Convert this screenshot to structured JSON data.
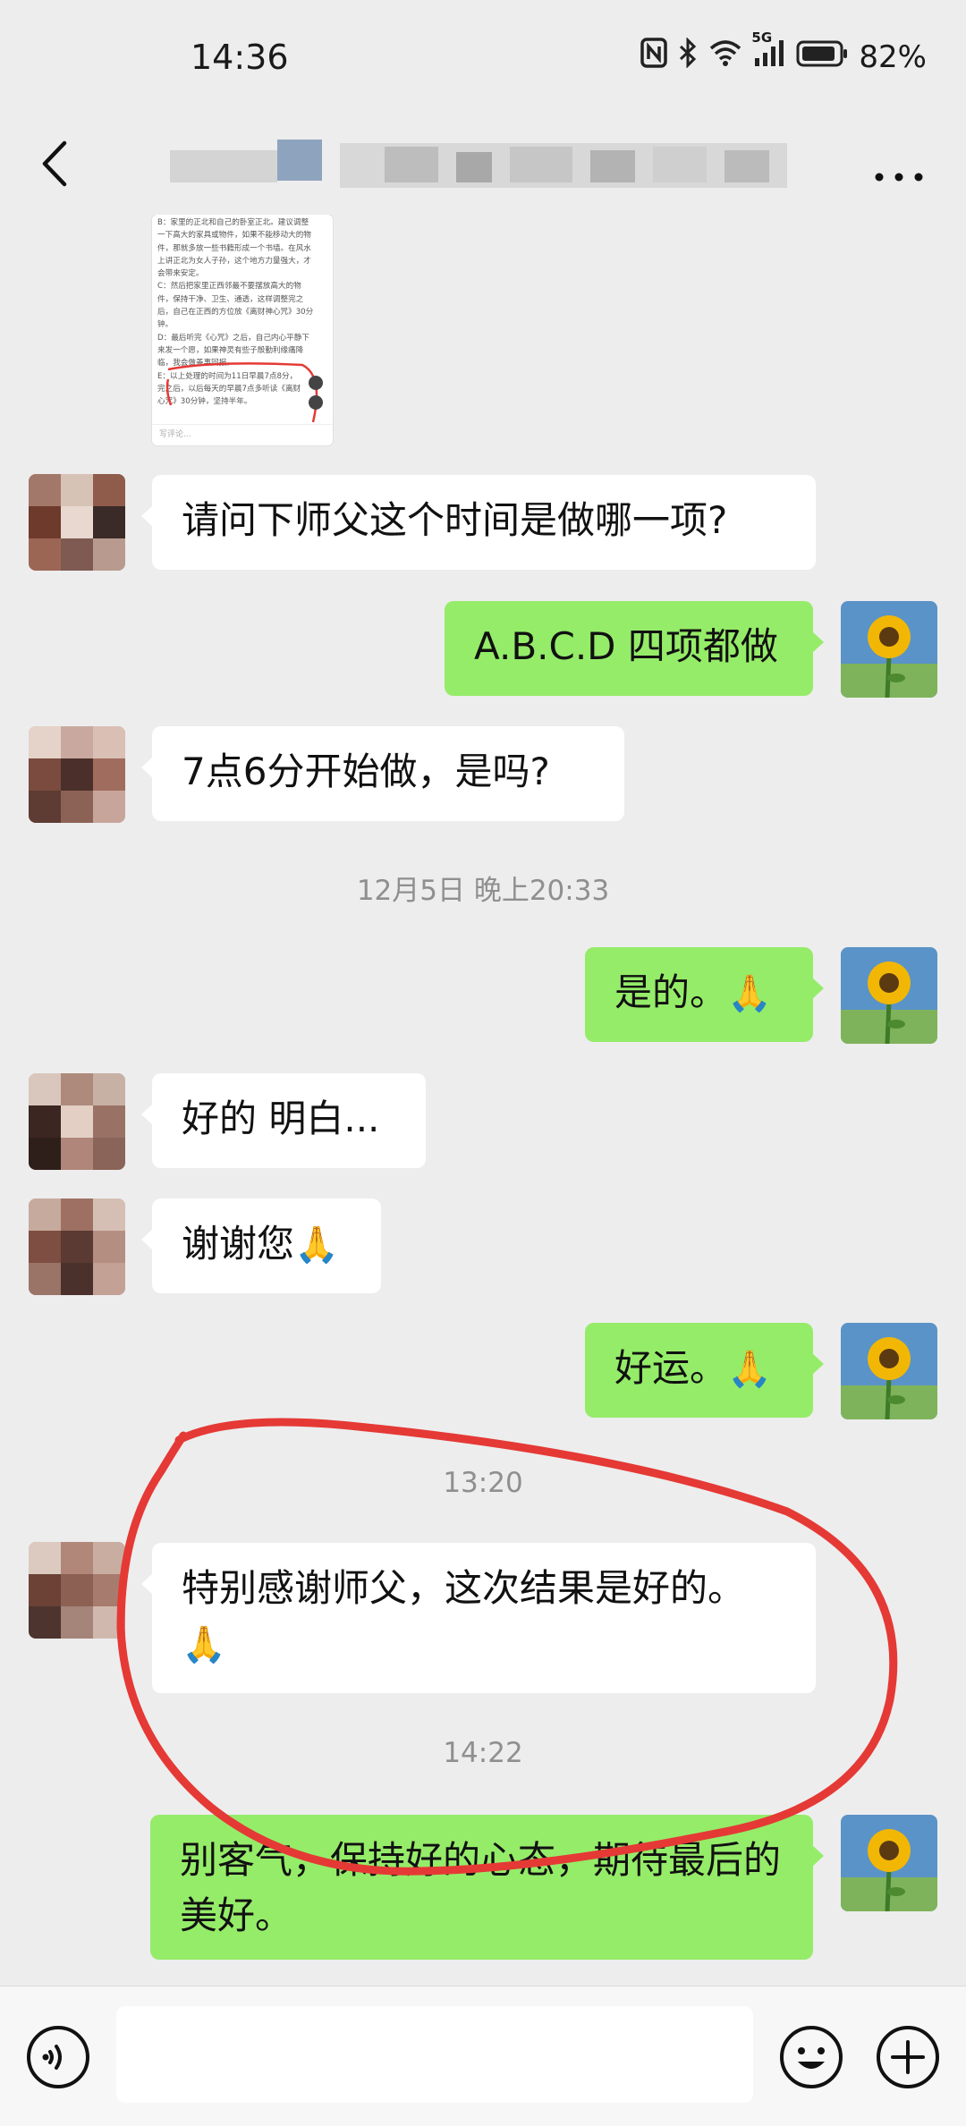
{
  "status_bar": {
    "time": "14:36",
    "network": "5G",
    "battery": "82%",
    "icons": [
      "nfc-icon",
      "bluetooth-icon",
      "wifi-icon",
      "signal-icon",
      "battery-icon"
    ]
  },
  "nav": {
    "back_icon": "chevron-left-icon",
    "more_icon": "more-dots-icon"
  },
  "image_message": {
    "lines": [
      "B：家里的正北和自己的卧室正北。建议调整",
      "一下高大的家具或物件，如果不能移动大的物",
      "件，那就多放一些书籍形成一个书墙。在风水",
      "上讲正北为女人子孙，这个地方力量强大，才",
      "会带来安定。",
      "C：然后把家里正西邻最不要摆放高大的物",
      "件，保持干净、卫生、通透，这样调整完之",
      "后，自己在正西的方位放《离财神心咒》30分",
      "钟。",
      "D：最后听完《心咒》之后，自己内心平静下",
      "来发一个愿，如果神灵有些子殷勤利缘痛降",
      "临，我会做善事回报。",
      "E：以上处理的时间为11日早晨7点8分，",
      "完之后，以后每天的早晨7点多听读《离财",
      "心咒》30分钟，坚持半年。"
    ],
    "footer_placeholder": "写评论..."
  },
  "messages": [
    {
      "side": "left",
      "text": "请问下师父这个时间是做哪一项?"
    },
    {
      "side": "right",
      "text": "A.B.C.D 四项都做"
    },
    {
      "side": "left",
      "text": "7点6分开始做，是吗?"
    },
    {
      "timestamp": "12月5日 晚上20:33"
    },
    {
      "side": "right",
      "text": "是的。",
      "emoji": "🙏"
    },
    {
      "side": "left",
      "text": "好的 明白..."
    },
    {
      "side": "left",
      "text": "谢谢您",
      "emoji": "🙏"
    },
    {
      "side": "right",
      "text": "好运。",
      "emoji": "🙏"
    },
    {
      "timestamp": "13:20"
    },
    {
      "side": "left",
      "text": "特别感谢师父，这次结果是好的。",
      "emoji": "🙏"
    },
    {
      "timestamp": "14:22"
    },
    {
      "side": "right",
      "text": "别客气，保持好的心态，期待最后的美好。"
    }
  ],
  "bottom_bar": {
    "voice_icon": "voice-icon",
    "emoji_icon": "emoji-icon",
    "add_icon": "plus-circle-icon"
  },
  "colors": {
    "background": "#ededed",
    "right_bubble": "#95ec69",
    "left_bubble": "#ffffff",
    "annotation": "#e53935"
  }
}
